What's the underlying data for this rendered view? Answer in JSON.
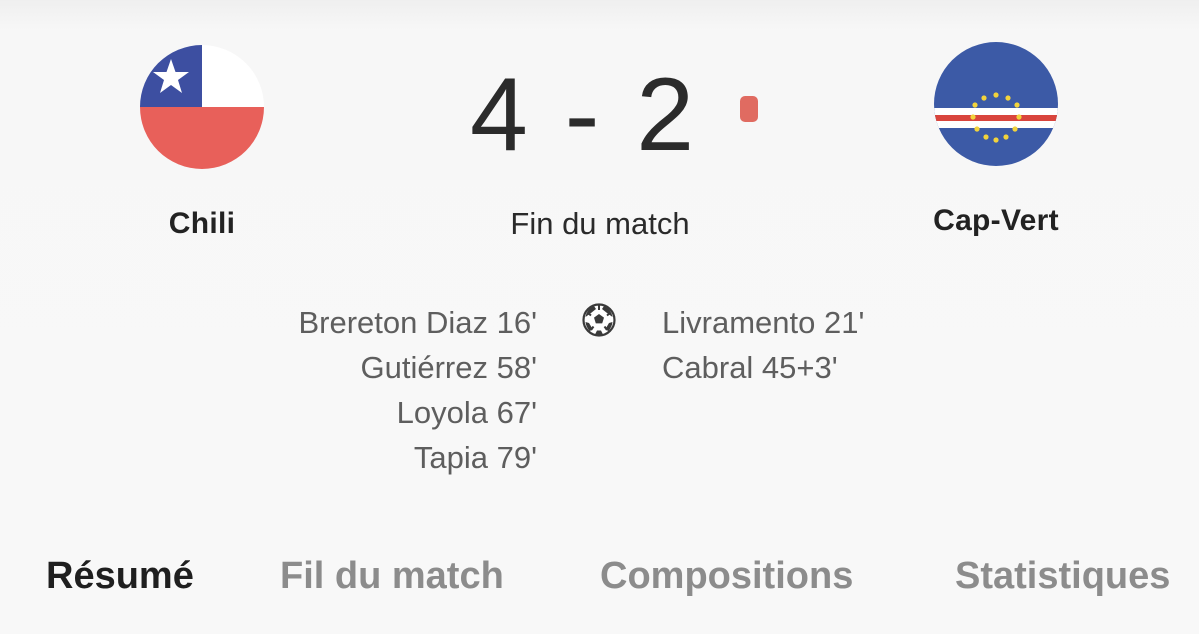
{
  "match": {
    "home_team": "Chili",
    "away_team": "Cap-Vert",
    "score": "4 - 2",
    "status": "Fin du match",
    "live_dot_color": "#e06b61"
  },
  "scorers": {
    "home": [
      "Brereton Diaz 16'",
      "Gutiérrez 58'",
      "Loyola 67'",
      "Tapia 79'"
    ],
    "away": [
      "Livramento 21'",
      "Cabral 45+3'"
    ]
  },
  "icons": {
    "goal": "soccer-ball-icon",
    "home_flag": "chile-flag-icon",
    "away_flag": "cape-verde-flag-icon"
  },
  "tabs": [
    {
      "label": "Résumé",
      "active": true
    },
    {
      "label": "Fil du match",
      "active": false
    },
    {
      "label": "Compositions",
      "active": false
    },
    {
      "label": "Statistiques",
      "active": false
    }
  ]
}
